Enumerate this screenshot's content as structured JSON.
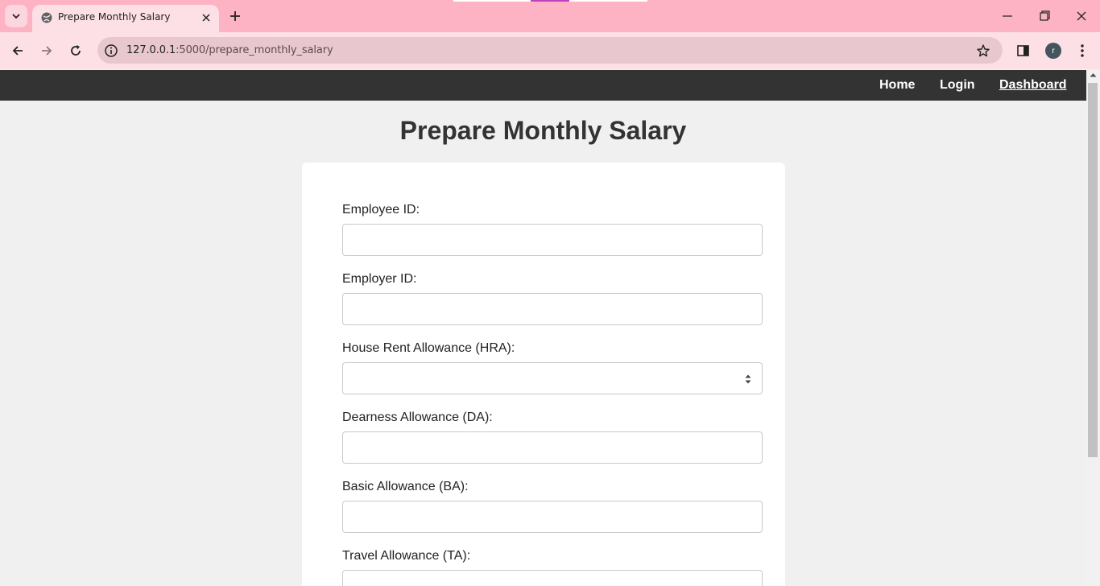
{
  "browser": {
    "tab_title": "Prepare Monthly Salary",
    "url_host": "127.0.0.1",
    "url_path": ":5000/prepare_monthly_salary",
    "profile_initial": "r"
  },
  "navbar": {
    "links": [
      "Home",
      "Login",
      "Dashboard"
    ],
    "active": "Dashboard"
  },
  "page": {
    "title": "Prepare Monthly Salary"
  },
  "form": {
    "fields": [
      {
        "label": "Employee ID:",
        "value": "",
        "type": "text"
      },
      {
        "label": "Employer ID:",
        "value": "",
        "type": "text"
      },
      {
        "label": "House Rent Allowance (HRA):",
        "value": "",
        "type": "number"
      },
      {
        "label": "Dearness Allowance (DA):",
        "value": "",
        "type": "text"
      },
      {
        "label": "Basic Allowance (BA):",
        "value": "",
        "type": "text"
      },
      {
        "label": "Travel Allowance (TA):",
        "value": "",
        "type": "text"
      }
    ]
  },
  "colors": {
    "tabbar": "#fdb3c3",
    "toolbar": "#fde0e6",
    "navbar": "#333333",
    "page_bg": "#f0f0f0",
    "card_bg": "#ffffff"
  }
}
